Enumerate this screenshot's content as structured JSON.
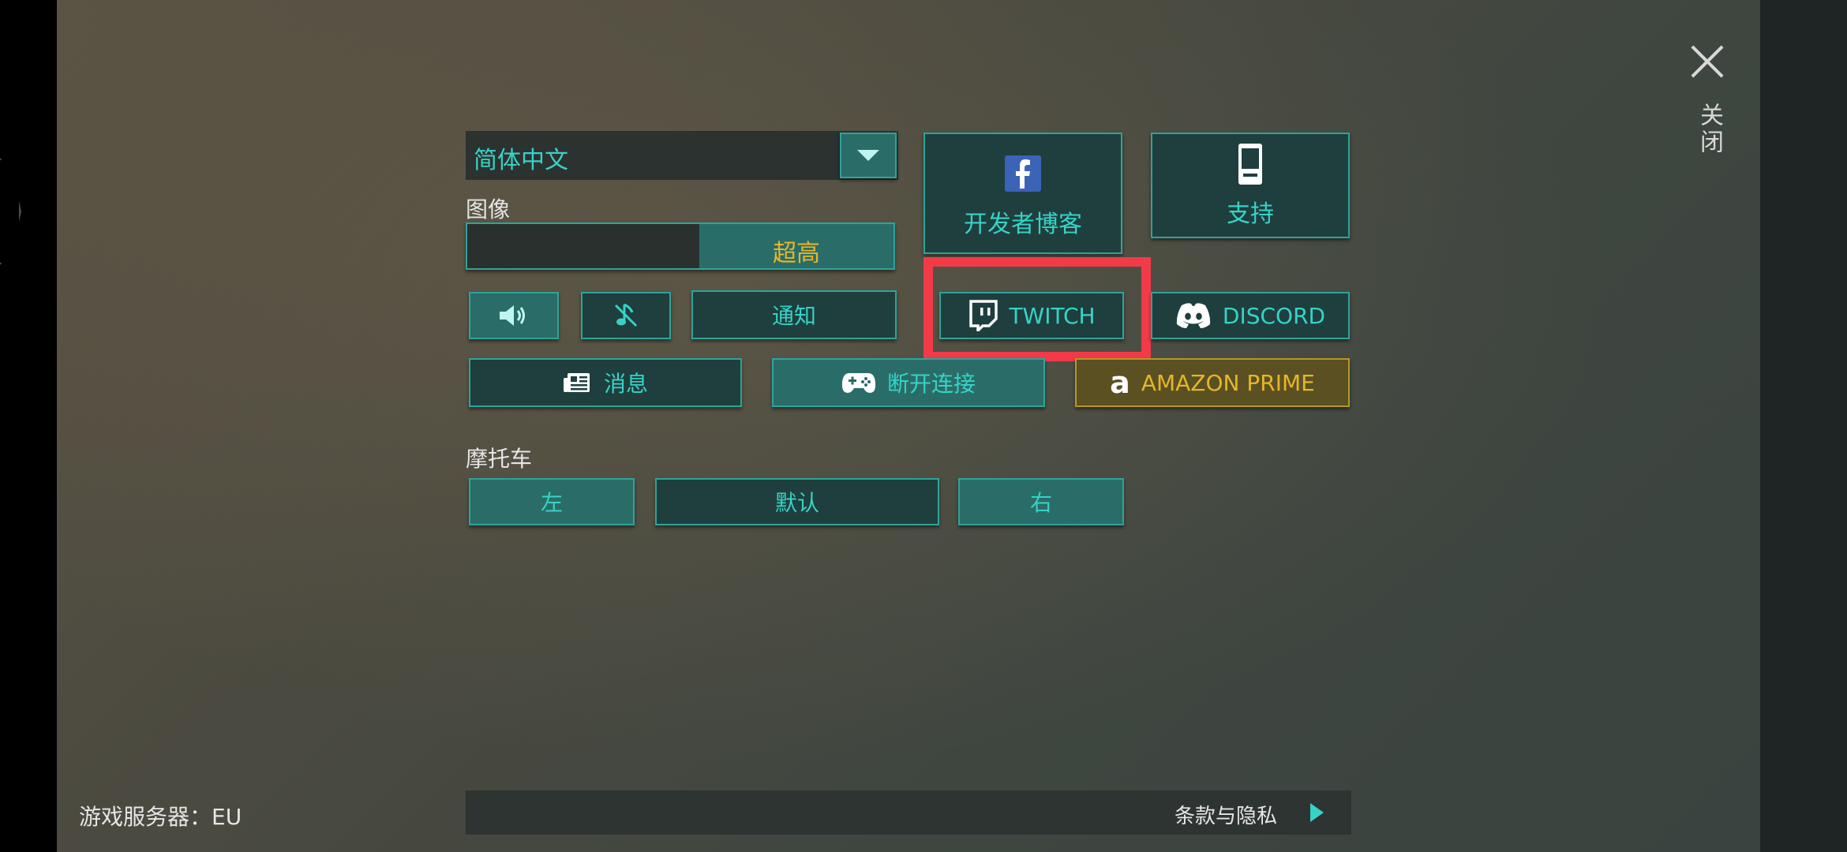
{
  "close": {
    "label": "关闭"
  },
  "language": {
    "selected": "简体中文"
  },
  "graphics": {
    "label": "图像",
    "level": "超高"
  },
  "audio": {
    "notify_label": "通知"
  },
  "links": {
    "dev_blog": "开发者博客",
    "support": "支持",
    "twitch": "TWITCH",
    "discord": "DISCORD",
    "news": "消息",
    "disconnect": "断开连接",
    "amazon": "AMAZON PRIME"
  },
  "motorcycle": {
    "label": "摩托车",
    "left": "左",
    "default": "默认",
    "right": "右"
  },
  "footer": {
    "server": "游戏服务器：EU",
    "terms": "条款与隐私"
  },
  "colors": {
    "accent": "#37d2c7",
    "highlight_box": "#f23a48",
    "amazon_text": "#e6b628"
  }
}
